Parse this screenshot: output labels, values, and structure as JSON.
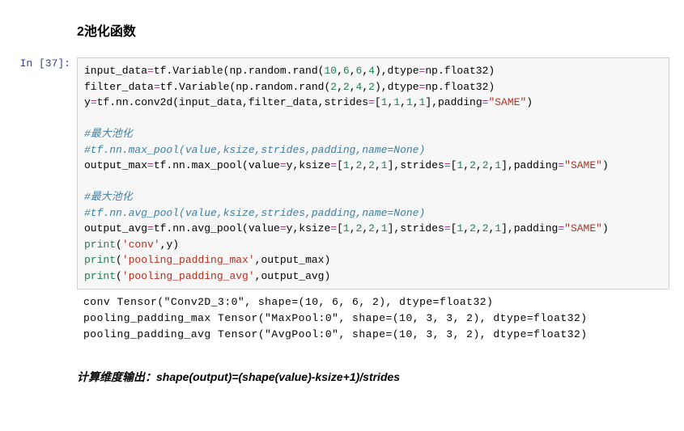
{
  "heading": "2池化函数",
  "prompt": "In  [37]:",
  "code": {
    "l1": {
      "a": "input_data",
      "b": "tf.Variable(np.random.rand(",
      "c": "10",
      "d": ",",
      "e": "6",
      "f": ",",
      "g": "6",
      "h": ",",
      "i": "4",
      "j": "),dtype",
      "k": "np.float32)"
    },
    "l2": {
      "a": "filter_data",
      "b": "tf.Variable(np.random.rand(",
      "c": "2",
      "d": ",",
      "e": "2",
      "f": ",",
      "g": "4",
      "h": ",",
      "i": "2",
      "j": "),dtype",
      "k": "np.float32)"
    },
    "l3": {
      "a": "y",
      "b": "tf.nn.conv2d(input_data,filter_data,strides",
      "c": "[",
      "d": "1",
      "e": ",",
      "f": "1",
      "g": ",",
      "h": "1",
      "i": ",",
      "j": "1",
      "k": "],padding",
      "l": "\"SAME\"",
      "m": ")"
    },
    "l5": "#最大池化",
    "l6": "#tf.nn.max_pool(value,ksize,strides,padding,name=None)",
    "l7": {
      "a": "output_max",
      "b": "tf.nn.max_pool(value",
      "c": "y,ksize",
      "d": "[",
      "e": "1",
      "f": ",",
      "g": "2",
      "h": ",",
      "i": "2",
      "j": ",",
      "k": "1",
      "l": "],strides",
      "m": "[",
      "n": "1",
      "o": ",",
      "p": "2",
      "q": ",",
      "r": "2",
      "s": ",",
      "t": "1",
      "u": "],padding",
      "v": "\"SAME\"",
      "w": ")"
    },
    "l9": "#最大池化",
    "l10": "#tf.nn.avg_pool(value,ksize,strides,padding,name=None)",
    "l11": {
      "a": "output_avg",
      "b": "tf.nn.avg_pool(value",
      "c": "y,ksize",
      "d": "[",
      "e": "1",
      "f": ",",
      "g": "2",
      "h": ",",
      "i": "2",
      "j": ",",
      "k": "1",
      "l": "],strides",
      "m": "[",
      "n": "1",
      "o": ",",
      "p": "2",
      "q": ",",
      "r": "2",
      "s": ",",
      "t": "1",
      "u": "],padding",
      "v": "\"SAME\"",
      "w": ")"
    },
    "l12": {
      "a": "print",
      "b": "(",
      "c": "'conv'",
      "d": ",y)"
    },
    "l13": {
      "a": "print",
      "b": "(",
      "c": "'pooling_padding_max'",
      "d": ",output_max)"
    },
    "l14": {
      "a": "print",
      "b": "(",
      "c": "'pooling_padding_avg'",
      "d": ",output_avg)"
    }
  },
  "output": {
    "l1": "conv Tensor(\"Conv2D_3:0\", shape=(10, 6, 6, 2), dtype=float32)",
    "l2": "pooling_padding_max Tensor(\"MaxPool:0\", shape=(10, 3, 3, 2), dtype=float32)",
    "l3": "pooling_padding_avg Tensor(\"AvgPool:0\", shape=(10, 3, 3, 2), dtype=float32)"
  },
  "note": "计算维度输出：shape(output)=(shape(value)-ksize+1)/strides"
}
